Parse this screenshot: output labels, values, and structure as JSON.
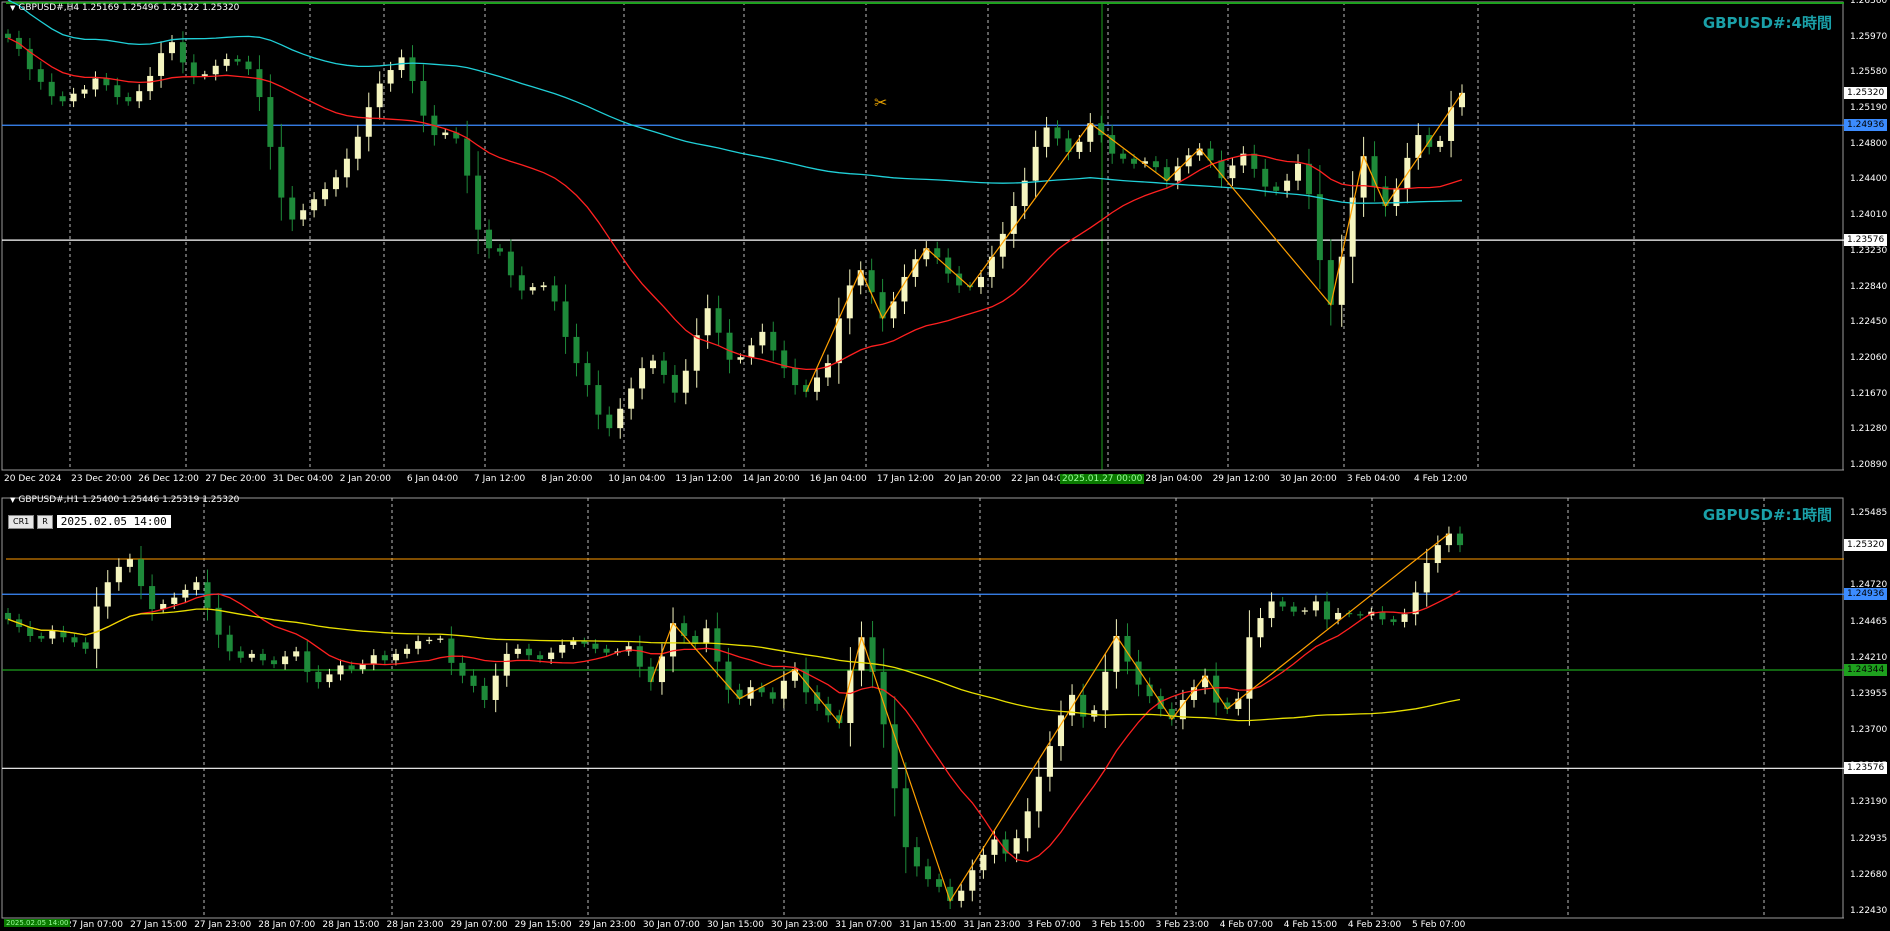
{
  "colors": {
    "background": "#000000",
    "bull": "#f5f5c0",
    "bear": "#1e8a3a",
    "ma_red": "#ff2020",
    "ma_cyan": "#20d0d8",
    "ma_yellow": "#e8e000",
    "zigzag": "#ffa000",
    "label": "#1aa0a8",
    "hline_white": "#ffffff",
    "hline_blue": "#3c8cff",
    "hline_green": "#1ea01e",
    "hline_orange": "#ff9a00"
  },
  "top_chart": {
    "header": "GBPUSD#,H4  1.25169 1.25496 1.25122 1.25320",
    "label": "GBPUSD#:4時間",
    "price_axis": [
      "1.26360",
      "1.25970",
      "1.25580",
      "1.25190",
      "1.24800",
      "1.24400",
      "1.24010",
      "1.23230",
      "1.22840",
      "1.22450",
      "1.22060",
      "1.21670",
      "1.21280",
      "1.20890"
    ],
    "price_tags": {
      "current": "1.25320",
      "blue": "1.24936",
      "white": "1.23576"
    },
    "time_axis": [
      "20 Dec 2024",
      "23 Dec 20:00",
      "26 Dec 12:00",
      "27 Dec 20:00",
      "31 Dec 04:00",
      "2 Jan 20:00",
      "6 Jan 04:00",
      "7 Jan 12:00",
      "8 Jan 20:00",
      "10 Jan 04:00",
      "13 Jan 12:00",
      "14 Jan 20:00",
      "16 Jan 04:00",
      "17 Jan 12:00",
      "20 Jan 20:00",
      "22 Jan 04:00",
      "23 Jan",
      "28 Jan 04:00",
      "29 Jan 12:00",
      "30 Jan 20:00",
      "3 Feb 04:00",
      "4 Feb 12:00"
    ],
    "time_highlight": "2025.01.27 00:00",
    "cursor_icon": "scissors-crosshair-icon"
  },
  "bottom_chart": {
    "header": "GBPUSD#,H1  1.25400 1.25446 1.25319 1.25320",
    "label": "GBPUSD#:1時間",
    "ctrl_buttons": [
      "CR1",
      "R"
    ],
    "datetime_box": "2025.02.05 14:00",
    "price_axis": [
      "1.25485",
      "1.25230",
      "1.24720",
      "1.24465",
      "1.24210",
      "1.23955",
      "1.23700",
      "1.23445",
      "1.23190",
      "1.22935",
      "1.22680",
      "1.22430"
    ],
    "price_tags": {
      "current": "1.25320",
      "blue": "1.24936",
      "green": "1.24344",
      "white": "1.23576"
    },
    "time_axis": [
      "27 Jan 07:00",
      "27 Jan 15:00",
      "27 Jan 23:00",
      "28 Jan 07:00",
      "28 Jan 15:00",
      "28 Jan 23:00",
      "29 Jan 07:00",
      "29 Jan 15:00",
      "29 Jan 23:00",
      "30 Jan 07:00",
      "30 Jan 15:00",
      "30 Jan 23:00",
      "31 Jan 07:00",
      "31 Jan 15:00",
      "31 Jan 23:00",
      "3 Feb 07:00",
      "3 Feb 15:00",
      "3 Feb 23:00",
      "4 Feb 07:00",
      "4 Feb 15:00",
      "4 Feb 23:00",
      "5 Feb 07:00"
    ],
    "time_highlight": "2025.02.05 14:00"
  },
  "chart_data": [
    {
      "type": "line",
      "title": "GBPUSD#:4時間",
      "ylim": [
        1.2089,
        1.2636
      ],
      "hlines": [
        1.24936,
        1.23576
      ],
      "close": [
        1.2597,
        1.2584,
        1.256,
        1.2545,
        1.2528,
        1.2522,
        1.2531,
        1.2536,
        1.2549,
        1.2541,
        1.2527,
        1.2522,
        1.2534,
        1.2552,
        1.2579,
        1.2592,
        1.2568,
        1.2552,
        1.2554,
        1.2564,
        1.2572,
        1.2569,
        1.256,
        1.2527,
        1.2468,
        1.2408,
        1.2382,
        1.2393,
        1.2406,
        1.2418,
        1.2432,
        1.2454,
        1.248,
        1.2515,
        1.2543,
        1.2559,
        1.2574,
        1.2546,
        1.2505,
        1.2482,
        1.2485,
        1.2478,
        1.2434,
        1.237,
        1.2348,
        1.2344,
        1.2316,
        1.2298,
        1.2302,
        1.2304,
        1.2285,
        1.2243,
        1.2212,
        1.2186,
        1.2151,
        1.2135,
        1.2158,
        1.2182,
        1.2206,
        1.2215,
        1.2198,
        1.2177,
        1.2203,
        1.2245,
        1.2277,
        1.2248,
        1.2216,
        1.2219,
        1.2233,
        1.2249,
        1.2227,
        1.2206,
        1.2186,
        1.2178,
        1.2195,
        1.2212,
        1.2265,
        1.2304,
        1.2322,
        1.2296,
        1.2265,
        1.2285,
        1.2314,
        1.2335,
        1.2348,
        1.2337,
        1.2318,
        1.2304,
        1.2302,
        1.2314,
        1.2338,
        1.2365,
        1.2398,
        1.2428,
        1.2468,
        1.2491,
        1.2478,
        1.2462,
        1.2474,
        1.2496,
        1.2482,
        1.246,
        1.2454,
        1.2448,
        1.2451,
        1.2444,
        1.2428,
        1.2445,
        1.2458,
        1.2466,
        1.2452,
        1.2431,
        1.2446,
        1.246,
        1.2442,
        1.2421,
        1.2416,
        1.2428,
        1.2448,
        1.2412,
        1.2334,
        1.2281,
        1.2338,
        1.2408,
        1.2457,
        1.2421,
        1.2398,
        1.2419,
        1.2455,
        1.2482,
        1.2468,
        1.2475,
        1.2515,
        1.2532
      ],
      "series": []
    },
    {
      "type": "line",
      "title": "GBPUSD#:1時間",
      "ylim": [
        1.2243,
        1.2561
      ],
      "hlines": [
        1.24936,
        1.24344,
        1.23576
      ],
      "close": [
        1.2474,
        1.2468,
        1.2461,
        1.2459,
        1.2465,
        1.246,
        1.2456,
        1.2451,
        1.2484,
        1.2503,
        1.2515,
        1.2521,
        1.25,
        1.2482,
        1.2486,
        1.2491,
        1.2497,
        1.2503,
        1.2483,
        1.2462,
        1.2449,
        1.2444,
        1.2447,
        1.2442,
        1.2439,
        1.2445,
        1.2449,
        1.2433,
        1.2425,
        1.2431,
        1.2438,
        1.2435,
        1.2439,
        1.2446,
        1.2442,
        1.2447,
        1.2451,
        1.2457,
        1.2458,
        1.2459,
        1.244,
        1.243,
        1.2422,
        1.2411,
        1.243,
        1.2447,
        1.2451,
        1.2446,
        1.2443,
        1.2448,
        1.2454,
        1.2457,
        1.2455,
        1.2451,
        1.2448,
        1.2449,
        1.2453,
        1.2437,
        1.2425,
        1.2445,
        1.2471,
        1.2461,
        1.2455,
        1.2467,
        1.2441,
        1.2419,
        1.2412,
        1.2421,
        1.2417,
        1.2412,
        1.2426,
        1.2435,
        1.2417,
        1.2408,
        1.2399,
        1.2393,
        1.2434,
        1.246,
        1.2433,
        1.2392,
        1.2342,
        1.2296,
        1.2281,
        1.2271,
        1.2265,
        1.2254,
        1.2262,
        1.2278,
        1.229,
        1.2302,
        1.2291,
        1.2303,
        1.2324,
        1.2351,
        1.2375,
        1.2399,
        1.2415,
        1.2398,
        1.2403,
        1.2433,
        1.2461,
        1.2441,
        1.2423,
        1.2414,
        1.2404,
        1.2396,
        1.2411,
        1.2421,
        1.243,
        1.2409,
        1.2404,
        1.2412,
        1.246,
        1.2475,
        1.2488,
        1.2484,
        1.248,
        1.2481,
        1.2488,
        1.2474,
        1.2479,
        1.2478,
        1.2477,
        1.248,
        1.2474,
        1.2472,
        1.2478,
        1.2495,
        1.2518,
        1.2532,
        1.2541,
        1.2532
      ],
      "series": []
    }
  ]
}
